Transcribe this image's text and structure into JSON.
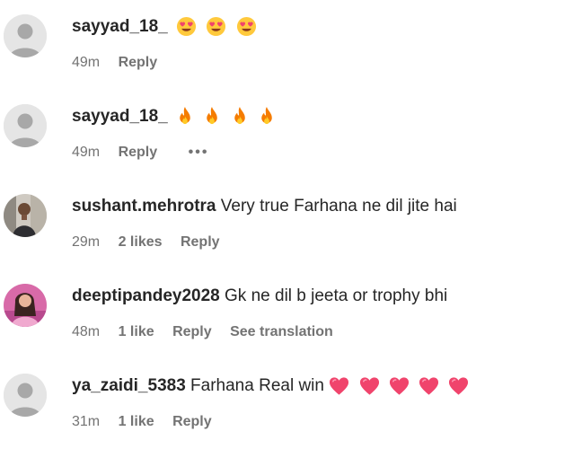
{
  "comments": [
    {
      "username": "sayyad_18_",
      "text": "",
      "emojis": [
        "heart-eyes",
        "heart-eyes",
        "heart-eyes"
      ],
      "time": "49m",
      "likes": "",
      "reply": "Reply",
      "translation": "",
      "avatar": "default"
    },
    {
      "username": "sayyad_18_",
      "text": "",
      "emojis": [
        "fire",
        "fire",
        "fire",
        "fire"
      ],
      "time": "49m",
      "likes": "",
      "reply": "Reply",
      "translation": "",
      "more": "•••",
      "avatar": "default"
    },
    {
      "username": "sushant.mehrotra",
      "text": "Very true Farhana ne dil jite hai",
      "emojis": [],
      "time": "29m",
      "likes": "2 likes",
      "reply": "Reply",
      "translation": "",
      "avatar": "photo-man"
    },
    {
      "username": "deeptipandey2028",
      "text": "Gk ne dil b jeeta or trophy bhi",
      "emojis": [],
      "time": "48m",
      "likes": "1 like",
      "reply": "Reply",
      "translation": "See translation",
      "avatar": "photo-woman"
    },
    {
      "username": "ya_zaidi_5383",
      "text": "Farhana Real win",
      "emojis": [
        "pink-heart",
        "pink-heart",
        "pink-heart",
        "pink-heart",
        "pink-heart"
      ],
      "time": "31m",
      "likes": "1 like",
      "reply": "Reply",
      "translation": "",
      "avatar": "default"
    }
  ],
  "colors": {
    "text": "#262626",
    "meta": "#737373",
    "avatar_bg": "#e5e5e5",
    "avatar_fg": "#a8a8a8",
    "heart": "#f0446c",
    "fire": "#f57c00"
  }
}
